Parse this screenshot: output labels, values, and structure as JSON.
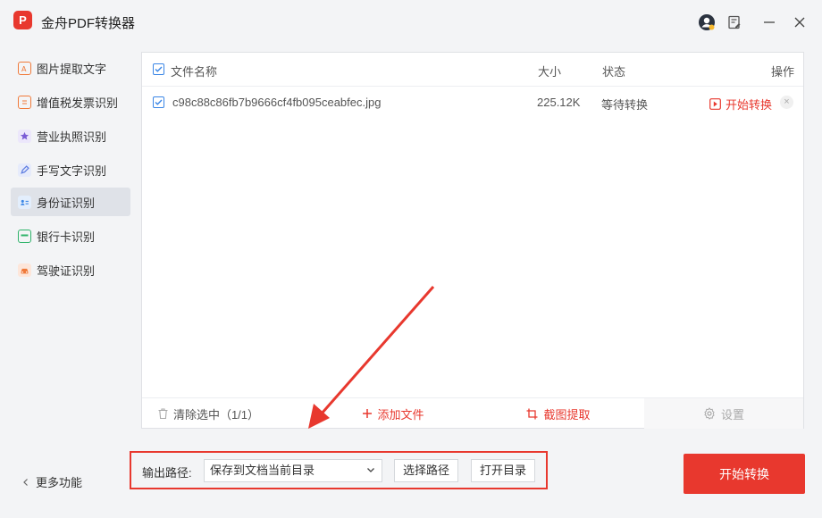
{
  "app": {
    "logo_text": "P",
    "title": "金舟PDF转换器"
  },
  "sidebar": {
    "items": [
      {
        "label": "图片提取文字",
        "icon": "image-text-icon",
        "color": "#f07a3a"
      },
      {
        "label": "增值税发票识别",
        "icon": "invoice-icon",
        "color": "#f07a3a"
      },
      {
        "label": "营业执照识别",
        "icon": "license-star-icon",
        "color": "#7b5cd6"
      },
      {
        "label": "手写文字识别",
        "icon": "pen-icon",
        "color": "#5b7be0"
      },
      {
        "label": "身份证识别",
        "icon": "id-card-icon",
        "color": "#3a86e6"
      },
      {
        "label": "银行卡识别",
        "icon": "bank-card-icon",
        "color": "#2fb36a"
      },
      {
        "label": "驾驶证识别",
        "icon": "car-icon",
        "color": "#f07a3a"
      }
    ],
    "active_index": 4,
    "more_label": "更多功能"
  },
  "table": {
    "headers": {
      "name": "文件名称",
      "size": "大小",
      "status": "状态",
      "action": "操作"
    },
    "rows": [
      {
        "name": "c98c88c86fb7b9666cf4fb095ceabfec.jpg",
        "size": "225.12K",
        "status": "等待转换",
        "action": "开始转换"
      }
    ]
  },
  "bottombar": {
    "clear_label": "清除选中（1/1）",
    "add_label": "添加文件",
    "crop_label": "截图提取",
    "settings_label": "设置"
  },
  "output": {
    "label": "输出路径:",
    "selected": "保存到文档当前目录",
    "choose_label": "选择路径",
    "open_label": "打开目录"
  },
  "start_label": "开始转换",
  "colors": {
    "accent": "#e8382e",
    "check": "#3a86e6"
  }
}
